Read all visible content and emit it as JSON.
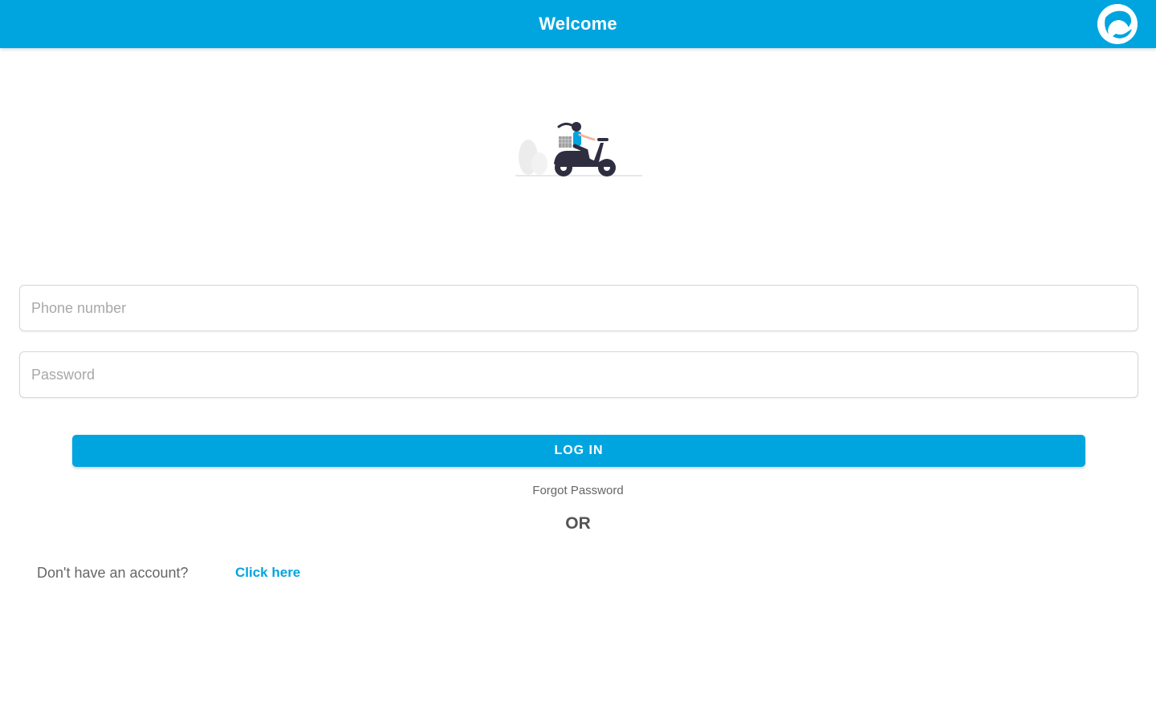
{
  "header": {
    "title": "Welcome",
    "logo_icon": "p-logo-icon",
    "logo_letter": "P",
    "bar_color": "#00a5e0"
  },
  "illustration": {
    "icon": "scooter-rider-illustration"
  },
  "form": {
    "phone_placeholder": "Phone number",
    "phone_value": "",
    "password_placeholder": "Password",
    "password_value": "",
    "login_label": "LOG IN",
    "forgot_label": "Forgot Password",
    "or_label": "OR"
  },
  "signup": {
    "prompt": "Don't have an account?",
    "link_label": "Click here",
    "link_color": "#00a5e0"
  }
}
